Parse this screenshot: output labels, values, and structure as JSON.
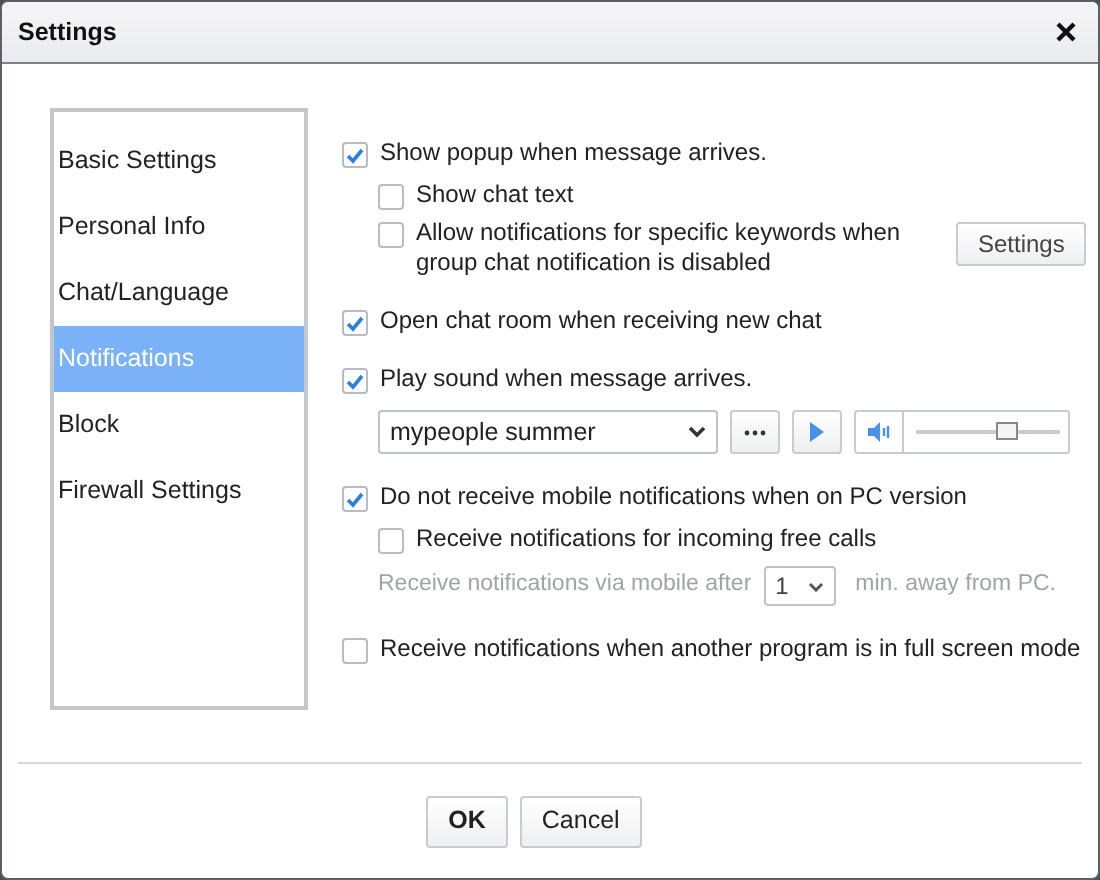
{
  "window": {
    "title": "Settings"
  },
  "sidebar": {
    "items": [
      {
        "label": "Basic Settings",
        "selected": false
      },
      {
        "label": "Personal Info",
        "selected": false
      },
      {
        "label": "Chat/Language",
        "selected": false
      },
      {
        "label": "Notifications",
        "selected": true
      },
      {
        "label": "Block",
        "selected": false
      },
      {
        "label": "Firewall Settings",
        "selected": false
      }
    ]
  },
  "options": [
    {
      "kind": "checkbox",
      "label": "Show popup when message arrives.",
      "checked": true,
      "children": [
        {
          "kind": "checkbox",
          "label": "Show chat text",
          "checked": false
        },
        {
          "kind": "checkbox",
          "label": "Allow notifications for specific keywords when group chat notification is disabled",
          "checked": false,
          "button": "Settings"
        }
      ]
    },
    {
      "kind": "checkbox",
      "label": "Open chat room when receiving new chat",
      "checked": true
    },
    {
      "kind": "checkbox",
      "label": "Play sound when message arrives.",
      "checked": true,
      "sound": {
        "selection": "mypeople summer",
        "volume": {
          "level": 0.62
        }
      }
    },
    {
      "kind": "checkbox",
      "label": "Do not receive mobile notifications when on PC version",
      "checked": true,
      "children": [
        {
          "kind": "checkbox",
          "label": "Receive notifications for incoming free calls",
          "checked": false
        },
        {
          "kind": "delay",
          "prefix": "Receive notifications via mobile after",
          "value": "1",
          "suffix": "min. away from PC.",
          "disabled": true
        }
      ]
    },
    {
      "kind": "checkbox",
      "label": "Receive notifications when another program is in full screen mode",
      "checked": false
    }
  ],
  "buttons": [
    {
      "label": "OK",
      "default": true
    },
    {
      "label": "Cancel",
      "default": false
    }
  ]
}
